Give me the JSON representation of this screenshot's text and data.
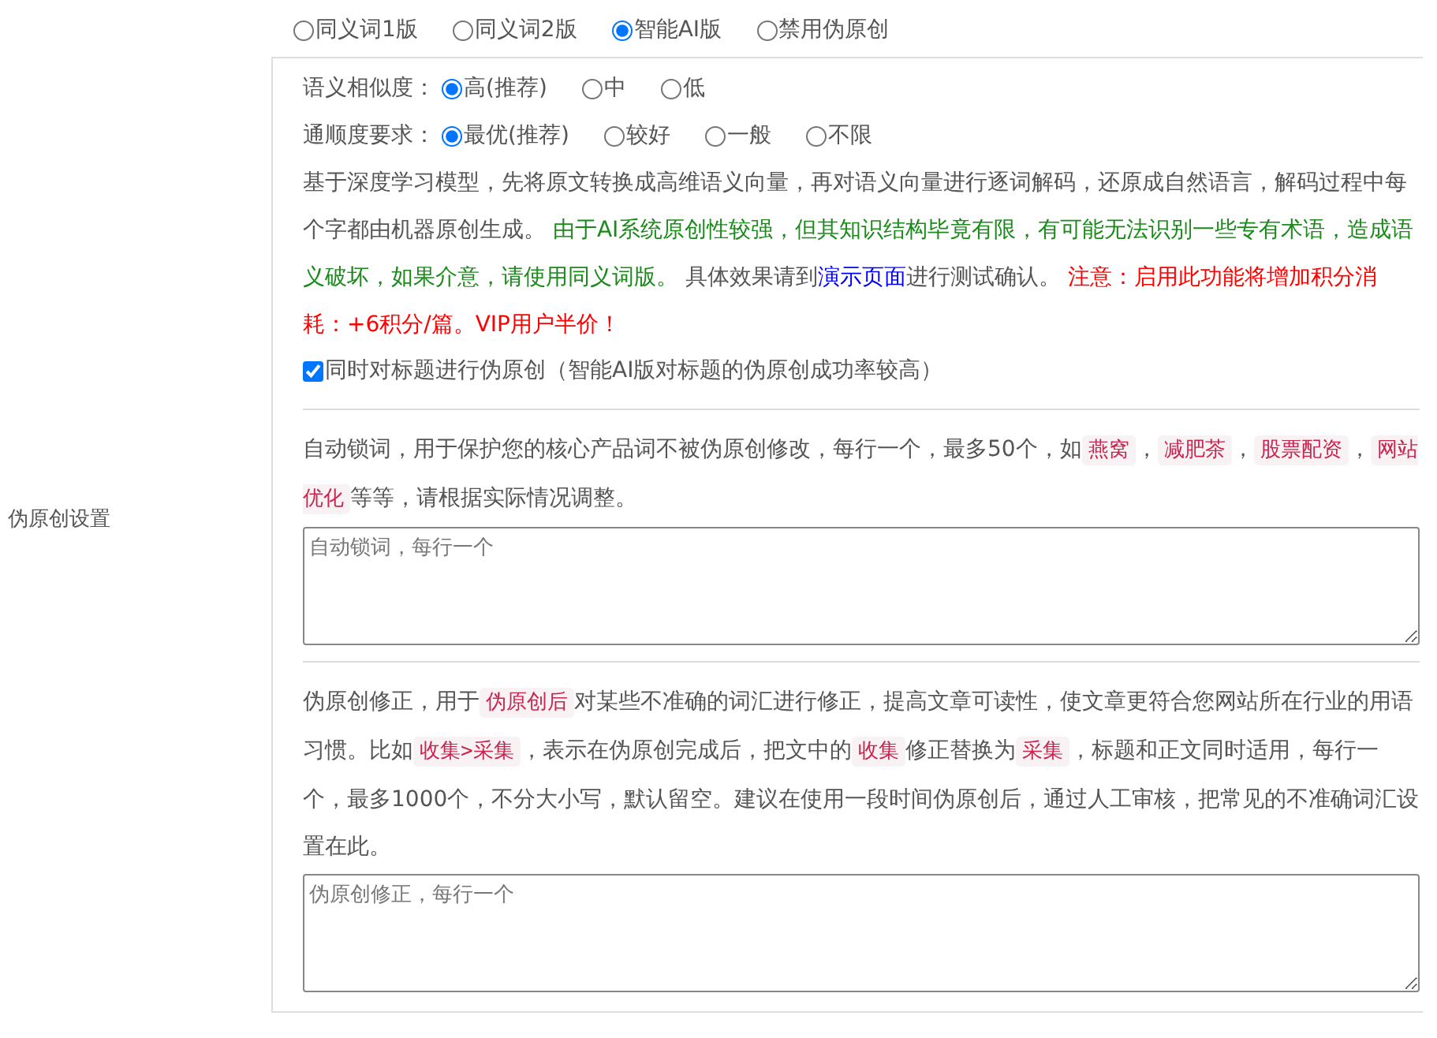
{
  "side_label": "伪原创设置",
  "modes": [
    {
      "label": "同义词1版",
      "selected": false
    },
    {
      "label": "同义词2版",
      "selected": false
    },
    {
      "label": "智能AI版",
      "selected": true
    },
    {
      "label": "禁用伪原创",
      "selected": false
    }
  ],
  "settings": [
    {
      "label": "语义相似度：",
      "options": [
        {
          "label": "高(推荐)",
          "selected": true
        },
        {
          "label": "中",
          "selected": false
        },
        {
          "label": "低",
          "selected": false
        }
      ]
    },
    {
      "label": "通顺度要求：",
      "options": [
        {
          "label": "最优(推荐)",
          "selected": true
        },
        {
          "label": "较好",
          "selected": false
        },
        {
          "label": "一般",
          "selected": false
        },
        {
          "label": "不限",
          "selected": false
        }
      ]
    }
  ],
  "description": [
    {
      "kind": "plain",
      "text": "基于深度学习模型，先将原文转换成高维语义向量，再对语义向量进行逐词解码，还原成自然语言，解码过程中每个字都由机器原创生成。 "
    },
    {
      "kind": "green",
      "text": "由于AI系统原创性较强，但其知识结构毕竟有限，有可能无法识别一些专有术语，造成语义破坏，如果介意，请使用同义词版。"
    },
    {
      "kind": "plain",
      "text": " 具体效果请到"
    },
    {
      "kind": "link",
      "text": "演示页面"
    },
    {
      "kind": "plain",
      "text": "进行测试确认。 "
    },
    {
      "kind": "red",
      "text": "注意：启用此功能将增加积分消耗：+6积分/篇。VIP用户半价！"
    }
  ],
  "title_option": {
    "label": "同时对标题进行伪原创（智能AI版对标题的伪原创成功率较高）",
    "checked": true
  },
  "lock_words": {
    "intro": [
      {
        "kind": "plain",
        "text": "自动锁词，用于保护您的核心产品词不被伪原创修改，每行一个，最多50个，如"
      },
      {
        "kind": "tag",
        "text": "燕窝"
      },
      {
        "kind": "plain",
        "text": "，"
      },
      {
        "kind": "tag",
        "text": "减肥茶"
      },
      {
        "kind": "plain",
        "text": "，"
      },
      {
        "kind": "tag",
        "text": "股票配资"
      },
      {
        "kind": "plain",
        "text": "，"
      },
      {
        "kind": "tag",
        "text": "网站优化"
      },
      {
        "kind": "plain",
        "text": "等等，请根据实际情况调整。"
      }
    ],
    "placeholder": "自动锁词，每行一个"
  },
  "correction": {
    "intro": [
      {
        "kind": "plain",
        "text": "伪原创修正，用于"
      },
      {
        "kind": "tag",
        "text": "伪原创后"
      },
      {
        "kind": "plain",
        "text": "对某些不准确的词汇进行修正，提高文章可读性，使文章更符合您网站所在行业的用语习惯。比如"
      },
      {
        "kind": "tag",
        "text": "收集>采集"
      },
      {
        "kind": "plain",
        "text": "，表示在伪原创完成后，把文中的"
      },
      {
        "kind": "tag",
        "text": "收集"
      },
      {
        "kind": "plain",
        "text": "修正替换为"
      },
      {
        "kind": "tag",
        "text": "采集"
      },
      {
        "kind": "plain",
        "text": "，标题和正文同时适用，每行一个，最多1000个，不分大小写，默认留空。建议在使用一段时间伪原创后，通过人工审核，把常见的不准确词汇设置在此。"
      }
    ],
    "placeholder": "伪原创修正，每行一个"
  }
}
